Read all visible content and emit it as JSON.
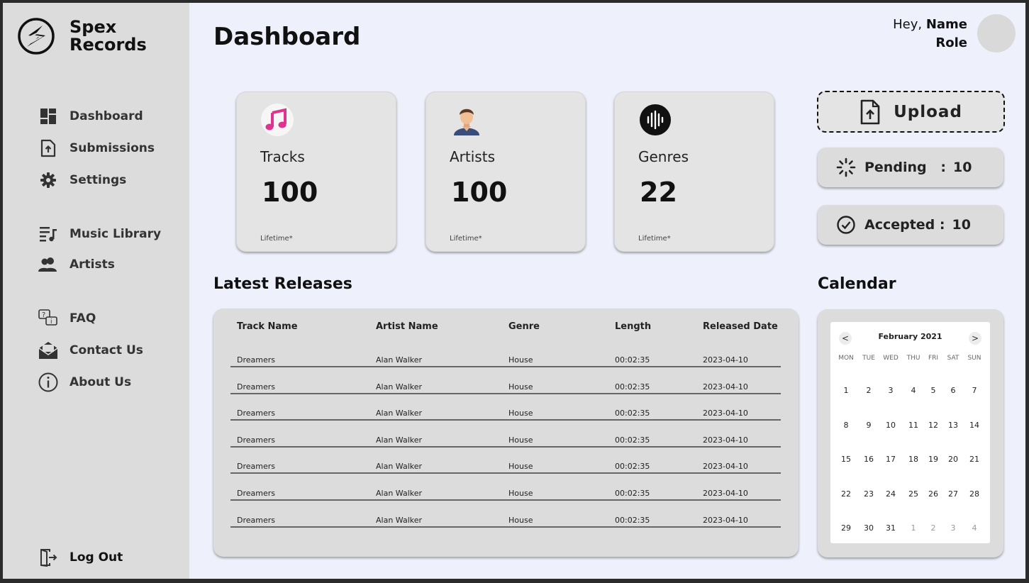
{
  "brand": {
    "name": "Spex\nRecords"
  },
  "nav": {
    "dashboard": "Dashboard",
    "submissions": "Submissions",
    "settings": "Settings",
    "music_library": "Music Library",
    "artists": "Artists",
    "faq": "FAQ",
    "contact": "Contact Us",
    "about": "About Us",
    "logout": "Log Out"
  },
  "header": {
    "title": "Dashboard",
    "greeting": "Hey,",
    "name": "Name",
    "role": "Role"
  },
  "stats": [
    {
      "label": "Tracks",
      "value": "100",
      "foot": "Lifetime*",
      "icon": "music-note-icon"
    },
    {
      "label": "Artists",
      "value": "100",
      "foot": "Lifetime*",
      "icon": "artist-avatar-icon"
    },
    {
      "label": "Genres",
      "value": "22",
      "foot": "Lifetime*",
      "icon": "sound-wave-icon"
    }
  ],
  "actions": {
    "upload": "Upload",
    "pending_label": "Pending   :",
    "pending_value": "10",
    "accepted_label": "Accepted :",
    "accepted_value": "10"
  },
  "releases": {
    "title": "Latest Releases",
    "columns": [
      "Track Name",
      "Artist Name",
      "Genre",
      "Length",
      "Released Date"
    ],
    "rows": [
      [
        "Dreamers",
        "Alan Walker",
        "House",
        "00:02:35",
        "2023-04-10"
      ],
      [
        "Dreamers",
        "Alan Walker",
        "House",
        "00:02:35",
        "2023-04-10"
      ],
      [
        "Dreamers",
        "Alan Walker",
        "House",
        "00:02:35",
        "2023-04-10"
      ],
      [
        "Dreamers",
        "Alan Walker",
        "House",
        "00:02:35",
        "2023-04-10"
      ],
      [
        "Dreamers",
        "Alan Walker",
        "House",
        "00:02:35",
        "2023-04-10"
      ],
      [
        "Dreamers",
        "Alan Walker",
        "House",
        "00:02:35",
        "2023-04-10"
      ],
      [
        "Dreamers",
        "Alan Walker",
        "House",
        "00:02:35",
        "2023-04-10"
      ]
    ]
  },
  "calendar": {
    "title": "Calendar",
    "month": "February 2021",
    "prev": "<",
    "next": ">",
    "weekdays": [
      "MON",
      "TUE",
      "WED",
      "THU",
      "FRI",
      "SAT",
      "SUN"
    ],
    "weeks": [
      [
        "1",
        "2",
        "3",
        "4",
        "5",
        "6",
        "7"
      ],
      [
        "8",
        "9",
        "10",
        "11",
        "12",
        "13",
        "14"
      ],
      [
        "15",
        "16",
        "17",
        "18",
        "19",
        "20",
        "21"
      ],
      [
        "22",
        "23",
        "24",
        "25",
        "26",
        "27",
        "28"
      ],
      [
        "29",
        "30",
        "31",
        "1",
        "2",
        "3",
        "4"
      ]
    ],
    "muted_from_week5_col": 3
  },
  "colors": {
    "sidebar": "#dcdcdc",
    "background": "#eef0fb",
    "music_icon": "#e0338f"
  }
}
